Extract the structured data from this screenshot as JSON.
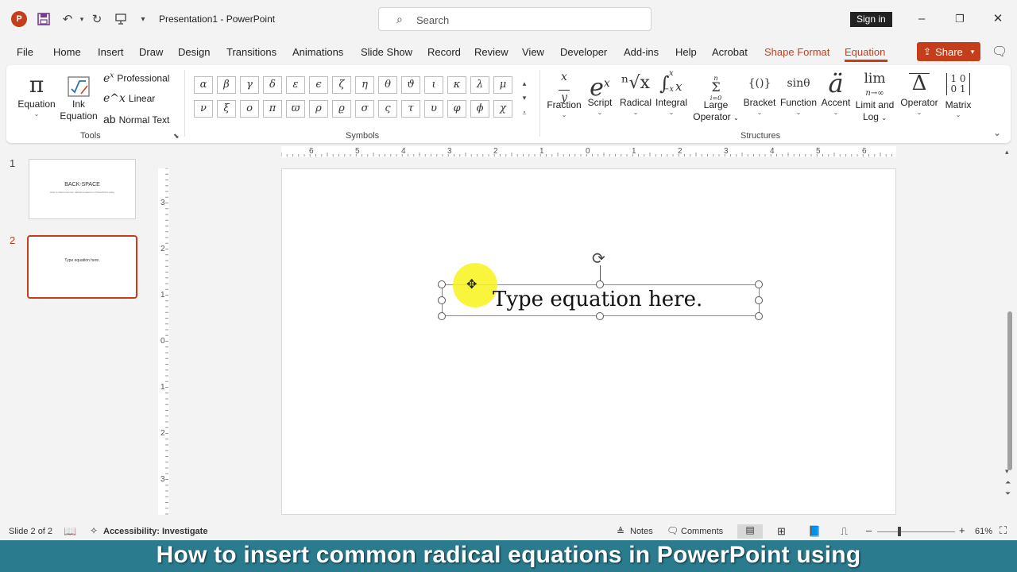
{
  "titlebar": {
    "app_logo": "P",
    "doc_title": "Presentation1  -  PowerPoint",
    "search_placeholder": "Search",
    "sign_in": "Sign in",
    "icons": [
      "save-icon",
      "undo-icon",
      "redo-icon",
      "present-icon",
      "customize-icon",
      "minimize-icon",
      "restore-icon",
      "close-icon"
    ]
  },
  "menu": {
    "tabs": [
      "File",
      "Home",
      "Insert",
      "Draw",
      "Design",
      "Transitions",
      "Animations",
      "Slide Show",
      "Record",
      "Review",
      "View",
      "Developer",
      "Add-ins",
      "Help",
      "Acrobat",
      "Shape Format",
      "Equation"
    ],
    "active_tab": "Equation",
    "share": "Share"
  },
  "ribbon": {
    "tools": {
      "label": "Tools",
      "equation": "Equation",
      "ink_equation_1": "Ink",
      "ink_equation_2": "Equation",
      "professional": "Professional",
      "linear": "Linear",
      "normal_text": "Normal Text"
    },
    "symbols": {
      "label": "Symbols",
      "row1": [
        "α",
        "β",
        "γ",
        "δ",
        "ε",
        "ϵ",
        "ζ",
        "η",
        "θ",
        "ϑ",
        "ι",
        "κ",
        "λ",
        "μ"
      ],
      "row2": [
        "ν",
        "ξ",
        "ο",
        "π",
        "ϖ",
        "ρ",
        "ϱ",
        "σ",
        "ς",
        "τ",
        "υ",
        "φ",
        "ϕ",
        "χ"
      ]
    },
    "structures": {
      "label": "Structures",
      "items": [
        {
          "label": "Fraction",
          "label2": ""
        },
        {
          "label": "Script",
          "label2": ""
        },
        {
          "label": "Radical",
          "label2": ""
        },
        {
          "label": "Integral",
          "label2": ""
        },
        {
          "label": "Large",
          "label2": "Operator"
        },
        {
          "label": "Bracket",
          "label2": ""
        },
        {
          "label": "Function",
          "label2": ""
        },
        {
          "label": "Accent",
          "label2": ""
        },
        {
          "label": "Limit and",
          "label2": "Log"
        },
        {
          "label": "Operator",
          "label2": ""
        },
        {
          "label": "Matrix",
          "label2": ""
        }
      ],
      "glyphs": {
        "script": "e",
        "script_sup": "x",
        "function": "sinθ",
        "bracket": "{()}",
        "accent": "ä",
        "limit": "lim",
        "limit_sub": "n→∞",
        "operator": "Δ",
        "radical": "ⁿ√x",
        "fraction_num": "x",
        "fraction_den": "y",
        "integral": "∫",
        "integral_var": "x",
        "integral_sup": "x",
        "integral_sub": "−x",
        "large_op": "Σ",
        "large_op_sup": "n",
        "large_op_sub": "i=0",
        "matrix_r1": "1 0",
        "matrix_r2": "0 1"
      }
    }
  },
  "slides": {
    "items": [
      {
        "number": "1",
        "title": "BACK-SPACE",
        "subtitle": "How to insert common radical equations in PowerPoint using"
      },
      {
        "number": "2",
        "text": "Type equation here."
      }
    ]
  },
  "ruler": {
    "horizontal": [
      "6",
      "5",
      "4",
      "3",
      "2",
      "1",
      "0",
      "1",
      "2",
      "3",
      "4",
      "5",
      "6"
    ],
    "vertical": [
      "3",
      "2",
      "1",
      "0",
      "1",
      "2",
      "3"
    ]
  },
  "slide": {
    "equation_placeholder": "Type equation here."
  },
  "status": {
    "slide_info": "Slide 2 of 2",
    "accessibility": "Accessibility: Investigate",
    "notes": "Notes",
    "comments": "Comments",
    "zoom": "61%",
    "zoom_level": 0.61
  },
  "caption": {
    "text": "How to insert common radical equations in PowerPoint using"
  }
}
